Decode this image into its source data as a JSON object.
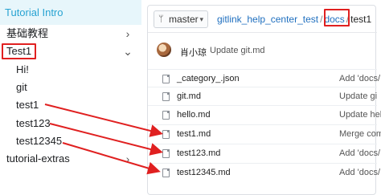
{
  "sidebar": {
    "header": "Tutorial Intro",
    "items": [
      {
        "label": "基础教程",
        "caret": "›"
      },
      {
        "label": "Test1",
        "caret": "⌄"
      },
      {
        "label": "Hi!"
      },
      {
        "label": "git"
      },
      {
        "label": "test1"
      },
      {
        "label": "test123"
      },
      {
        "label": "test12345"
      },
      {
        "label": "tutorial-extras",
        "caret": "›"
      }
    ]
  },
  "repo": {
    "branch": "master",
    "breadcrumb": {
      "repo": "gitlink_help_center_test",
      "folder": "docs",
      "current": "test1",
      "separator": "/"
    },
    "latest_commit": {
      "author": "肖小琼",
      "message": "Update git.md"
    },
    "files": [
      {
        "name": "_category_.json",
        "message": "Add 'docs/"
      },
      {
        "name": "git.md",
        "message": "Update gi"
      },
      {
        "name": "hello.md",
        "message": "Update hel"
      },
      {
        "name": "test1.md",
        "message": "Merge comr"
      },
      {
        "name": "test123.md",
        "message": "Add 'docs/"
      },
      {
        "name": "test12345.md",
        "message": "Add 'docs/"
      }
    ]
  },
  "colors": {
    "accent": "#28a3d2",
    "highlight_box": "#e02020",
    "arrow": "#e02020",
    "link": "#1f6fbf"
  }
}
